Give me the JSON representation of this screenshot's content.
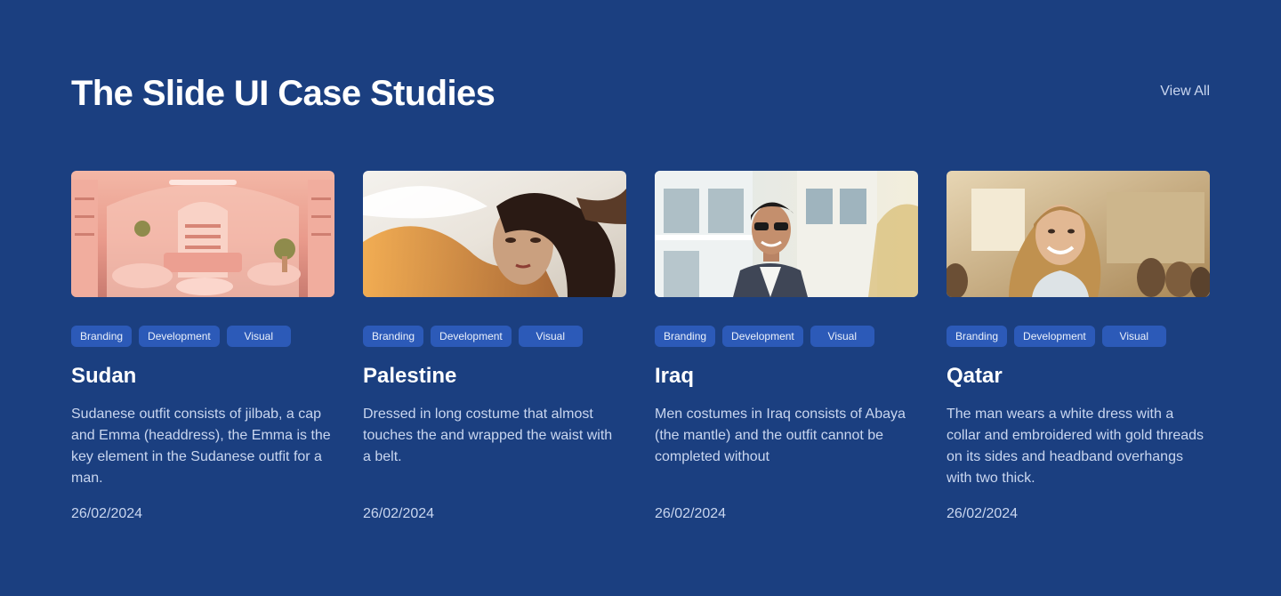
{
  "header": {
    "title": "The Slide UI Case Studies",
    "view_all_label": "View All"
  },
  "cards": [
    {
      "image": "pink-boutique-interior-photo",
      "tags": [
        "Branding",
        "Development",
        "Visual"
      ],
      "title": "Sudan",
      "description": "Sudanese outfit consists of jilbab, a cap and Emma (headdress), the Emma is the key element in the Sudanese outfit for a man.",
      "date": "26/02/2024"
    },
    {
      "image": "woman-with-flowing-fabric-photo",
      "tags": [
        "Branding",
        "Development",
        "Visual"
      ],
      "title": "Palestine",
      "description": "Dressed in long costume that almost touches the and wrapped the waist with a belt.",
      "date": "26/02/2024"
    },
    {
      "image": "smiling-man-in-sunglasses-photo",
      "tags": [
        "Branding",
        "Development",
        "Visual"
      ],
      "title": "Iraq",
      "description": "Men costumes in Iraq consists of Abaya (the mantle) and the outfit cannot be completed without",
      "date": "26/02/2024"
    },
    {
      "image": "smiling-woman-in-classroom-photo",
      "tags": [
        "Branding",
        "Development",
        "Visual"
      ],
      "title": "Qatar",
      "description": "The man wears a white dress with a collar and embroidered with gold threads on its sides and headband overhangs with two thick.",
      "date": "26/02/2024"
    }
  ],
  "colors": {
    "background": "#1b3f80",
    "tag_background": "#2c5ab8",
    "muted_text": "#c9d6ef"
  }
}
